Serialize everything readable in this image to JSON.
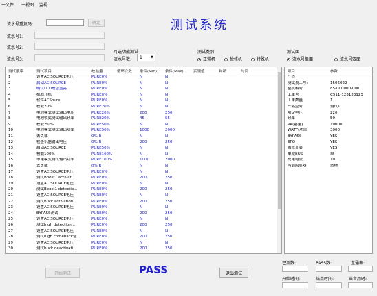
{
  "menu": [
    "一文件",
    "一视图",
    "监视"
  ],
  "app_title": "测试系统",
  "serial_main": {
    "label": "流水号重复码:",
    "value": "",
    "button": "确定"
  },
  "serial_fields": [
    {
      "label": "流水号1:",
      "value": ""
    },
    {
      "label": "流水号2:",
      "value": ""
    },
    {
      "label": "流水号3:",
      "value": ""
    }
  ],
  "optional": {
    "title": "可选功能测试",
    "param_label": "流水号数:",
    "param_value": "1"
  },
  "test_category": {
    "title": "测试类别",
    "options": [
      {
        "label": "正常机",
        "checked": true
      },
      {
        "label": "检修机",
        "checked": false
      },
      {
        "label": "特殊机",
        "checked": false
      }
    ]
  },
  "test_side": {
    "title": "测试面",
    "options": [
      {
        "label": "流水号单面",
        "checked": true
      },
      {
        "label": "流水号双面",
        "checked": false
      }
    ]
  },
  "table": {
    "headers": [
      "测试顺序",
      "测试项目",
      "校验量",
      "循环次数",
      "条件(Min)",
      "条件(Max)",
      "实测值",
      "判断",
      "时间"
    ],
    "rows": [
      [
        "1",
        "设置AC SOURCE电压",
        "PURE0%",
        "",
        "N",
        "N"
      ],
      [
        "2",
        "启动AC SOURCE",
        "PURE0%",
        "",
        "N",
        "N"
      ],
      [
        "3",
        "确认LCD是否显亮",
        "PURE0%",
        "",
        "N",
        "N"
      ],
      [
        "4",
        "机器开机",
        "PURE0%",
        "",
        "N",
        "N"
      ],
      [
        "5",
        "软件ACSoure",
        "PURE0%",
        "",
        "N",
        "N"
      ],
      [
        "6",
        "校载20%",
        "PURE20%",
        "",
        "N",
        "N"
      ],
      [
        "7",
        "电池模式测试输出电压",
        "PURE20%",
        "",
        "200",
        "250"
      ],
      [
        "8",
        "电池模式测试输出频率",
        "PURE20%",
        "",
        "45",
        "55"
      ],
      [
        "9",
        "校载 50%",
        "PURE50%",
        "",
        "N",
        "N"
      ],
      [
        "10",
        "电池模式测试输出功率",
        "PURE50%",
        "",
        "1000",
        "2000"
      ],
      [
        "11",
        "去负载",
        "0% R",
        "",
        "N",
        "N"
      ],
      [
        "12",
        "检查机器输出电压",
        "0% R",
        "",
        "200",
        "250"
      ],
      [
        "13",
        "启动AC SOURCE",
        "PURE50%",
        "",
        "N",
        "N"
      ],
      [
        "14",
        "校载100%",
        "PURE100%",
        "",
        "N",
        "N"
      ],
      [
        "15",
        "市电模式测试输出功率",
        "PURE100%",
        "",
        "1000",
        "2000"
      ],
      [
        "16",
        "去负载",
        "0% R",
        "",
        "N",
        "N"
      ],
      [
        "17",
        "设置AC SOURCE电压",
        "PURE0%",
        "",
        "N",
        "N"
      ],
      [
        "18",
        "测试Boost1 activati...",
        "PURE0%",
        "",
        "200",
        "250"
      ],
      [
        "19",
        "设置AC SOURCE电压",
        "PURE0%",
        "",
        "N",
        "N"
      ],
      [
        "20",
        "测试Boost1 detectio...",
        "PURE0%",
        "",
        "200",
        "250"
      ],
      [
        "21",
        "设置AC SOURCE电压",
        "PURE0%",
        "",
        "N",
        "N"
      ],
      [
        "22",
        "测试buck activation...",
        "PURE0%",
        "",
        "200",
        "250"
      ],
      [
        "23",
        "设置AC SOURCE电压",
        "PURE0%",
        "",
        "N",
        "N"
      ],
      [
        "24",
        "BYPASS测试",
        "PURE0%",
        "",
        "200",
        "250"
      ],
      [
        "25",
        "设置AC SOURCE电压",
        "PURE0%",
        "",
        "N",
        "N"
      ],
      [
        "26",
        "测试high detection...",
        "PURE0%",
        "",
        "200",
        "250"
      ],
      [
        "27",
        "设置AC SOURCE电压",
        "PURE0%",
        "",
        "N",
        "N"
      ],
      [
        "28",
        "测试high comeback验...",
        "PURE0%",
        "",
        "200",
        "250"
      ],
      [
        "29",
        "设置AC SOURCE电压",
        "PURE0%",
        "",
        "N",
        "N"
      ],
      [
        "30",
        "测试buck deactivati...",
        "PURE0%",
        "",
        "200",
        "250"
      ]
    ],
    "blue_rows": [
      1,
      2
    ]
  },
  "params": {
    "headers": [
      "项目",
      "参数"
    ],
    "rows": [
      [
        "产线",
        ""
      ],
      [
        "测试员工号:",
        "1506022"
      ],
      [
        "整机料号",
        "85-000000-000"
      ],
      [
        "工单号",
        "C511-123123123"
      ],
      [
        "工单数量",
        "1"
      ],
      [
        "产品型号",
        "测试1"
      ],
      [
        "额定电压",
        "220"
      ],
      [
        "频率",
        "50"
      ],
      [
        "VA(容量)",
        "10000"
      ],
      [
        "WATT(功率)",
        "3000"
      ],
      [
        "BYPASS",
        "YES"
      ],
      [
        "EPO",
        "YES"
      ],
      [
        "维修开关",
        "YES"
      ],
      [
        "单双BUS",
        "单"
      ],
      [
        "充电电流",
        "10"
      ],
      [
        "当前服务器",
        "本地"
      ]
    ]
  },
  "result": "PASS",
  "buttons": {
    "start": "开始测试",
    "exit": "退出测试"
  },
  "stats": {
    "tested": "已测数:",
    "pass_count": "PASS数:",
    "yield": "直通率:",
    "start_time": "开始时间:",
    "end_time": "结束时间:",
    "elapsed": "当台用时:"
  }
}
